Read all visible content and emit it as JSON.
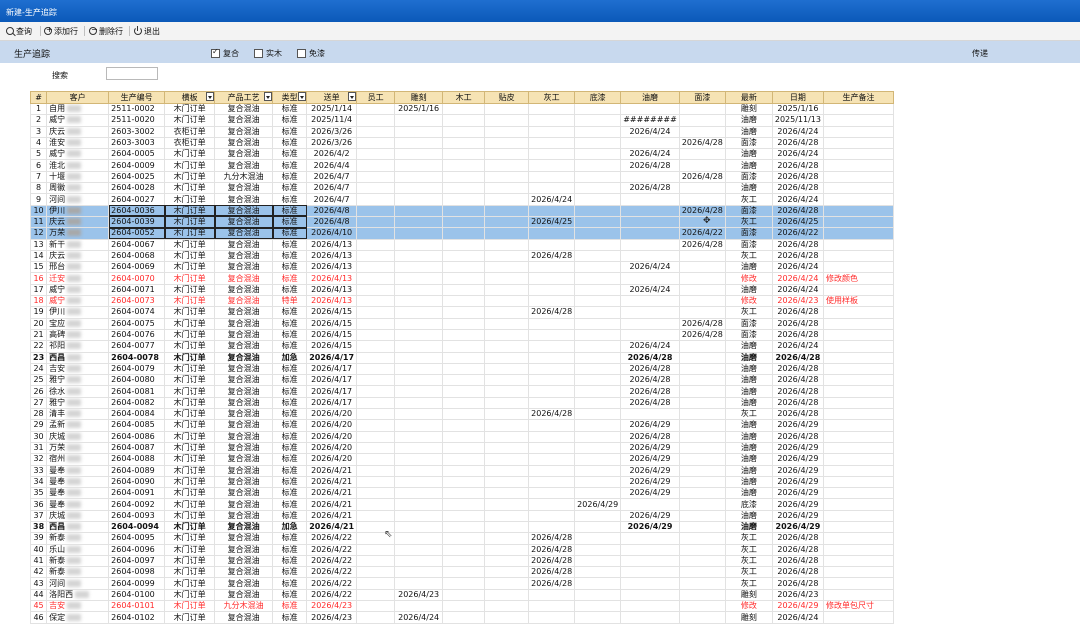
{
  "window": {
    "title": "新建-生产追踪"
  },
  "toolbar": {
    "query_label": "查询",
    "add_label": "添加行",
    "delete_label": "删除行",
    "exit_label": "退出"
  },
  "header": {
    "title": "生产追踪",
    "checks": [
      {
        "label": "复合",
        "checked": true
      },
      {
        "label": "实木",
        "checked": false
      },
      {
        "label": "免漆",
        "checked": false
      }
    ],
    "right_label": "传递"
  },
  "search": {
    "label": "搜索",
    "value": ""
  },
  "columns": [
    "#",
    "客户",
    "生产编号",
    "横板",
    "产品工艺",
    "类型",
    "送单",
    "员工",
    "雕刻",
    "木工",
    "贴皮",
    "灰工",
    "底漆",
    "油磨",
    "面漆",
    "最新",
    "日期",
    "生产备注"
  ],
  "rows": [
    [
      "1",
      "自用",
      "2511-0002",
      "木门订单",
      "复合混油",
      "标准",
      "2025/1/14",
      "",
      "2025/1/16",
      "",
      "",
      "",
      "",
      "",
      "",
      "雕刻",
      "2025/1/16",
      ""
    ],
    [
      "2",
      "威宁",
      "2511-0020",
      "木门订单",
      "复合混油",
      "标准",
      "2025/11/4",
      "",
      "",
      "",
      "",
      "",
      "",
      "########",
      "",
      "油磨",
      "2025/11/13",
      ""
    ],
    [
      "3",
      "庆云",
      "2603-3002",
      "衣柜订单",
      "复合混油",
      "标准",
      "2026/3/26",
      "",
      "",
      "",
      "",
      "",
      "",
      "2026/4/24",
      "",
      "油磨",
      "2026/4/24",
      ""
    ],
    [
      "4",
      "淮安",
      "2603-3003",
      "衣柜订单",
      "复合混油",
      "标准",
      "2026/3/26",
      "",
      "",
      "",
      "",
      "",
      "",
      "",
      "2026/4/28",
      "面漆",
      "2026/4/28",
      ""
    ],
    [
      "5",
      "威宁",
      "2604-0005",
      "木门订单",
      "复合混油",
      "标准",
      "2026/4/2",
      "",
      "",
      "",
      "",
      "",
      "",
      "2026/4/24",
      "",
      "油磨",
      "2026/4/24",
      ""
    ],
    [
      "6",
      "淮北",
      "2604-0009",
      "木门订单",
      "复合混油",
      "标准",
      "2026/4/4",
      "",
      "",
      "",
      "",
      "",
      "",
      "2026/4/28",
      "",
      "油磨",
      "2026/4/28",
      ""
    ],
    [
      "7",
      "十堰",
      "2604-0025",
      "木门订单",
      "九分木混油",
      "标准",
      "2026/4/7",
      "",
      "",
      "",
      "",
      "",
      "",
      "",
      "2026/4/28",
      "面漆",
      "2026/4/28",
      ""
    ],
    [
      "8",
      "周徽",
      "2604-0028",
      "木门订单",
      "复合混油",
      "标准",
      "2026/4/7",
      "",
      "",
      "",
      "",
      "",
      "",
      "2026/4/28",
      "",
      "油磨",
      "2026/4/28",
      ""
    ],
    [
      "9",
      "河间",
      "2604-0027",
      "木门订单",
      "复合混油",
      "标准",
      "2026/4/7",
      "",
      "",
      "",
      "",
      "2026/4/24",
      "",
      "",
      "",
      "灰工",
      "2026/4/24",
      ""
    ],
    [
      "10",
      "伊川",
      "2604-0036",
      "木门订单",
      "复合混油",
      "标准",
      "2026/4/8",
      "",
      "",
      "",
      "",
      "",
      "",
      "",
      "2026/4/28",
      "面漆",
      "2026/4/28",
      ""
    ],
    [
      "11",
      "庆云",
      "2604-0039",
      "木门订单",
      "复合混油",
      "标准",
      "2026/4/8",
      "",
      "",
      "",
      "",
      "2026/4/25",
      "",
      "",
      "",
      "灰工",
      "2026/4/25",
      ""
    ],
    [
      "12",
      "万荣",
      "2604-0052",
      "木门订单",
      "复合混油",
      "标准",
      "2026/4/10",
      "",
      "",
      "",
      "",
      "",
      "",
      "",
      "2026/4/22",
      "面漆",
      "2026/4/22",
      ""
    ],
    [
      "13",
      "新干",
      "2604-0067",
      "木门订单",
      "复合混油",
      "标准",
      "2026/4/13",
      "",
      "",
      "",
      "",
      "",
      "",
      "",
      "2026/4/28",
      "面漆",
      "2026/4/28",
      ""
    ],
    [
      "14",
      "庆云",
      "2604-0068",
      "木门订单",
      "复合混油",
      "标准",
      "2026/4/13",
      "",
      "",
      "",
      "",
      "2026/4/28",
      "",
      "",
      "",
      "灰工",
      "2026/4/28",
      ""
    ],
    [
      "15",
      "邢台",
      "2604-0069",
      "木门订单",
      "复合混油",
      "标准",
      "2026/4/13",
      "",
      "",
      "",
      "",
      "",
      "",
      "2026/4/24",
      "",
      "油磨",
      "2026/4/24",
      ""
    ],
    [
      "16",
      "迁安",
      "2604-0070",
      "木门订单",
      "复合混油",
      "标准",
      "2026/4/13",
      "",
      "",
      "",
      "",
      "",
      "",
      "",
      "",
      "修改",
      "2026/4/24",
      "修改颜色"
    ],
    [
      "17",
      "威宁",
      "2604-0071",
      "木门订单",
      "复合混油",
      "标准",
      "2026/4/13",
      "",
      "",
      "",
      "",
      "",
      "",
      "2026/4/24",
      "",
      "油磨",
      "2026/4/24",
      ""
    ],
    [
      "18",
      "威宁",
      "2604-0073",
      "木门订单",
      "复合混油",
      "特单",
      "2026/4/13",
      "",
      "",
      "",
      "",
      "",
      "",
      "",
      "",
      "修改",
      "2026/4/23",
      "使用样板"
    ],
    [
      "19",
      "伊川",
      "2604-0074",
      "木门订单",
      "复合混油",
      "标准",
      "2026/4/15",
      "",
      "",
      "",
      "",
      "2026/4/28",
      "",
      "",
      "",
      "灰工",
      "2026/4/28",
      ""
    ],
    [
      "20",
      "宝应",
      "2604-0075",
      "木门订单",
      "复合混油",
      "标准",
      "2026/4/15",
      "",
      "",
      "",
      "",
      "",
      "",
      "",
      "2026/4/28",
      "面漆",
      "2026/4/28",
      ""
    ],
    [
      "21",
      "高碑",
      "2604-0076",
      "木门订单",
      "复合混油",
      "标准",
      "2026/4/15",
      "",
      "",
      "",
      "",
      "",
      "",
      "",
      "2026/4/28",
      "面漆",
      "2026/4/28",
      ""
    ],
    [
      "22",
      "祁阳",
      "2604-0077",
      "木门订单",
      "复合混油",
      "标准",
      "2026/4/15",
      "",
      "",
      "",
      "",
      "",
      "",
      "2026/4/24",
      "",
      "油磨",
      "2026/4/24",
      ""
    ],
    [
      "23",
      "西昌",
      "2604-0078",
      "木门订单",
      "复合混油",
      "加急",
      "2026/4/17",
      "",
      "",
      "",
      "",
      "",
      "",
      "2026/4/28",
      "",
      "油磨",
      "2026/4/28",
      ""
    ],
    [
      "24",
      "吉安",
      "2604-0079",
      "木门订单",
      "复合混油",
      "标准",
      "2026/4/17",
      "",
      "",
      "",
      "",
      "",
      "",
      "2026/4/28",
      "",
      "油磨",
      "2026/4/28",
      ""
    ],
    [
      "25",
      "雅宁",
      "2604-0080",
      "木门订单",
      "复合混油",
      "标准",
      "2026/4/17",
      "",
      "",
      "",
      "",
      "",
      "",
      "2026/4/28",
      "",
      "油磨",
      "2026/4/28",
      ""
    ],
    [
      "26",
      "徐水",
      "2604-0081",
      "木门订单",
      "复合混油",
      "标准",
      "2026/4/17",
      "",
      "",
      "",
      "",
      "",
      "",
      "2026/4/28",
      "",
      "油磨",
      "2026/4/28",
      ""
    ],
    [
      "27",
      "雅宁",
      "2604-0082",
      "木门订单",
      "复合混油",
      "标准",
      "2026/4/17",
      "",
      "",
      "",
      "",
      "",
      "",
      "2026/4/28",
      "",
      "油磨",
      "2026/4/28",
      ""
    ],
    [
      "28",
      "清丰",
      "2604-0084",
      "木门订单",
      "复合混油",
      "标准",
      "2026/4/20",
      "",
      "",
      "",
      "",
      "2026/4/28",
      "",
      "",
      "",
      "灰工",
      "2026/4/28",
      ""
    ],
    [
      "29",
      "孟新",
      "2604-0085",
      "木门订单",
      "复合混油",
      "标准",
      "2026/4/20",
      "",
      "",
      "",
      "",
      "",
      "",
      "2026/4/29",
      "",
      "油磨",
      "2026/4/29",
      ""
    ],
    [
      "30",
      "庆城",
      "2604-0086",
      "木门订单",
      "复合混油",
      "标准",
      "2026/4/20",
      "",
      "",
      "",
      "",
      "",
      "",
      "2026/4/28",
      "",
      "油磨",
      "2026/4/28",
      ""
    ],
    [
      "31",
      "万荣",
      "2604-0087",
      "木门订单",
      "复合混油",
      "标准",
      "2026/4/20",
      "",
      "",
      "",
      "",
      "",
      "",
      "2026/4/29",
      "",
      "油磨",
      "2026/4/29",
      ""
    ],
    [
      "32",
      "宿州",
      "2604-0088",
      "木门订单",
      "复合混油",
      "标准",
      "2026/4/20",
      "",
      "",
      "",
      "",
      "",
      "",
      "2026/4/29",
      "",
      "油磨",
      "2026/4/29",
      ""
    ],
    [
      "33",
      "曼奉",
      "2604-0089",
      "木门订单",
      "复合混油",
      "标准",
      "2026/4/21",
      "",
      "",
      "",
      "",
      "",
      "",
      "2026/4/29",
      "",
      "油磨",
      "2026/4/29",
      ""
    ],
    [
      "34",
      "曼奉",
      "2604-0090",
      "木门订单",
      "复合混油",
      "标准",
      "2026/4/21",
      "",
      "",
      "",
      "",
      "",
      "",
      "2026/4/29",
      "",
      "油磨",
      "2026/4/29",
      ""
    ],
    [
      "35",
      "曼奉",
      "2604-0091",
      "木门订单",
      "复合混油",
      "标准",
      "2026/4/21",
      "",
      "",
      "",
      "",
      "",
      "",
      "2026/4/29",
      "",
      "油磨",
      "2026/4/29",
      ""
    ],
    [
      "36",
      "曼奉",
      "2604-0092",
      "木门订单",
      "复合混油",
      "标准",
      "2026/4/21",
      "",
      "",
      "",
      "",
      "",
      "2026/4/29",
      "",
      "",
      "底漆",
      "2026/4/29",
      ""
    ],
    [
      "37",
      "庆城",
      "2604-0093",
      "木门订单",
      "复合混油",
      "标准",
      "2026/4/21",
      "",
      "",
      "",
      "",
      "",
      "",
      "2026/4/29",
      "",
      "油磨",
      "2026/4/29",
      ""
    ],
    [
      "38",
      "西昌",
      "2604-0094",
      "木门订单",
      "复合混油",
      "加急",
      "2026/4/21",
      "",
      "",
      "",
      "",
      "",
      "",
      "2026/4/29",
      "",
      "油磨",
      "2026/4/29",
      ""
    ],
    [
      "39",
      "新泰",
      "2604-0095",
      "木门订单",
      "复合混油",
      "标准",
      "2026/4/22",
      "",
      "",
      "",
      "",
      "2026/4/28",
      "",
      "",
      "",
      "灰工",
      "2026/4/28",
      ""
    ],
    [
      "40",
      "乐山",
      "2604-0096",
      "木门订单",
      "复合混油",
      "标准",
      "2026/4/22",
      "",
      "",
      "",
      "",
      "2026/4/28",
      "",
      "",
      "",
      "灰工",
      "2026/4/28",
      ""
    ],
    [
      "41",
      "新泰",
      "2604-0097",
      "木门订单",
      "复合混油",
      "标准",
      "2026/4/22",
      "",
      "",
      "",
      "",
      "2026/4/28",
      "",
      "",
      "",
      "灰工",
      "2026/4/28",
      ""
    ],
    [
      "42",
      "新泰",
      "2604-0098",
      "木门订单",
      "复合混油",
      "标准",
      "2026/4/22",
      "",
      "",
      "",
      "",
      "2026/4/28",
      "",
      "",
      "",
      "灰工",
      "2026/4/28",
      ""
    ],
    [
      "43",
      "河间",
      "2604-0099",
      "木门订单",
      "复合混油",
      "标准",
      "2026/4/22",
      "",
      "",
      "",
      "",
      "2026/4/28",
      "",
      "",
      "",
      "灰工",
      "2026/4/28",
      ""
    ],
    [
      "44",
      "洛阳西",
      "2604-0100",
      "木门订单",
      "复合混油",
      "标准",
      "2026/4/22",
      "",
      "2026/4/23",
      "",
      "",
      "",
      "",
      "",
      "",
      "雕刻",
      "2026/4/23",
      ""
    ],
    [
      "45",
      "吉安",
      "2604-0101",
      "木门订单",
      "九分木混油",
      "标准",
      "2026/4/23",
      "",
      "",
      "",
      "",
      "",
      "",
      "",
      "",
      "修改",
      "2026/4/29",
      "修改单包尺寸"
    ],
    [
      "46",
      "保定",
      "2604-0102",
      "木门订单",
      "复合混油",
      "标准",
      "2026/4/23",
      "",
      "2026/4/24",
      "",
      "",
      "",
      "",
      "",
      "",
      "雕刻",
      "2026/4/24",
      ""
    ]
  ],
  "selected_rows": [
    "10",
    "11",
    "12"
  ],
  "red_rows": [
    "16",
    "18",
    "45"
  ],
  "bold_rows": [
    "23",
    "38"
  ]
}
